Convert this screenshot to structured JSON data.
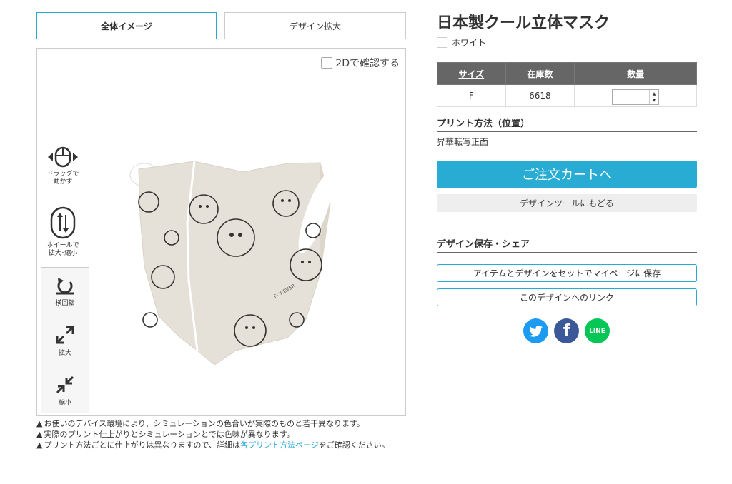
{
  "tabs": [
    {
      "label": "全体イメージ"
    },
    {
      "label": "デザイン拡大"
    }
  ],
  "viewer": {
    "check_2d_label": "2Dで確認する",
    "drag_label_1": "ドラッグで",
    "drag_label_2": "動かす",
    "wheel_label_1": "ホイールで",
    "wheel_label_2": "拡大･縮小",
    "rotate_label": "横回転",
    "zoom_in_label": "拡大",
    "zoom_out_label": "縮小",
    "mask_brand": "FOREVER"
  },
  "notes": {
    "note1": "お使いのデバイス環境により、シミュレーションの色合いが実際のものと若干異なります。",
    "note2": "実際のプリント仕上がりとシミュレーションとでは色味が異なります。",
    "note3_a": "プリント方法ごとに仕上がりは異なりますので、詳細は",
    "note3_link": "各プリント方法ページ",
    "note3_b": "をご確認ください。"
  },
  "product": {
    "title": "日本製クール立体マスク",
    "color_name": "ホワイト"
  },
  "stock_table": {
    "headers": [
      "サイズ",
      "在庫数",
      "数量"
    ],
    "rows": [
      {
        "size": "F",
        "stock": "6618"
      }
    ]
  },
  "print": {
    "heading": "プリント方法（位置）",
    "value": "昇華転写正面"
  },
  "actions": {
    "cart_label": "ご注文カートへ",
    "back_label": "デザインツールにもどる"
  },
  "share": {
    "heading": "デザイン保存・シェア",
    "save_label": "アイテムとデザインをセットでマイページに保存",
    "link_label": "このデザインへのリンク",
    "line_label": "LINE"
  },
  "colors": {
    "accent": "#29a9d6",
    "cart": "#29acd3",
    "twitter": "#1d9bf0",
    "facebook": "#3b5998",
    "line": "#06c755",
    "mask": "#e6e1d8"
  }
}
